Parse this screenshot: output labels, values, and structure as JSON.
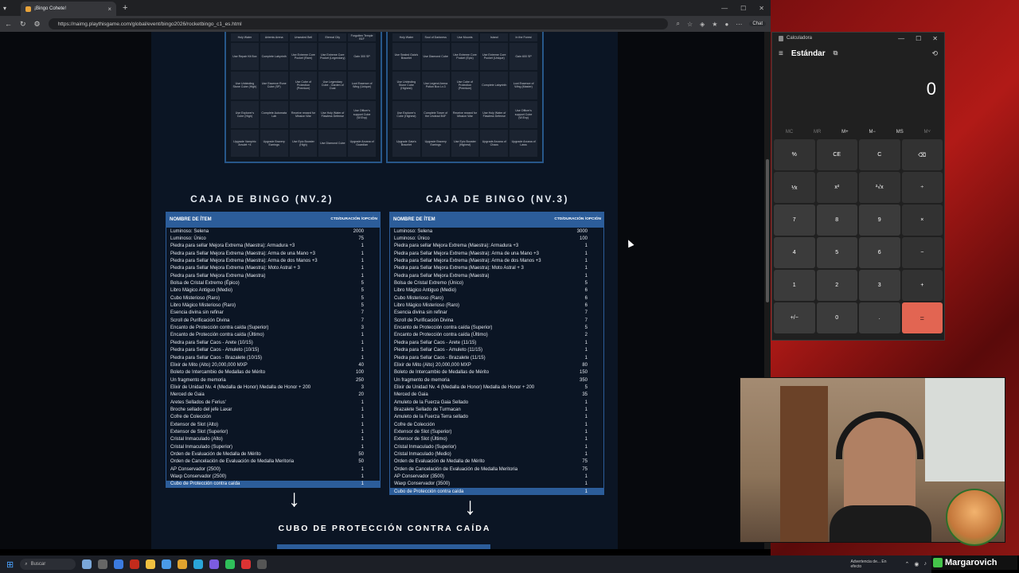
{
  "browser": {
    "tab_title": "¡Bingo Cohete!",
    "url": "https://naimg.playthisgame.com/global/event/bingo2026/rocketbingo_c1_es.html",
    "chat_label": "Chat"
  },
  "grids": {
    "left_cells": [
      "Holy Water",
      "Artemis Arena",
      "Unsealed Bell",
      "Eternal City",
      "Forgotten Temple B1F",
      "Use Repair Kit Box",
      "Complete Labyrinth",
      "Use Extreme Core Pocket (Rare)",
      "Use Extreme Core Pocket (Legendary)",
      "Gain 300 SP",
      "Use Unbinding Stone Cube (High)",
      "Use Essence Rune Cube (SP)",
      "Use Cube of Protection (Premium)",
      "Use Legendary Cube - Garden of Dust",
      "Loot Essence of Wing (Unique)",
      "Use Explorer's Cube (High)",
      "Complete Automata Lab",
      "Receive reward for Mission War",
      "Use Holy Water of Flawless Defense",
      "Use Officer's support Cube (W.Exp)",
      "Upgrade Vampiric Amulet +4",
      "Upgrade Bravery Earrings",
      "Use Epic Booster (High)",
      "Use Diamond Cube",
      "Upgrade Arcana of Guardian"
    ],
    "right_cells": [
      "Holy Water",
      "Soul of Darkness",
      "Use Mounts",
      "Island",
      "In the Forest",
      "Use Sealed Gaia's Bracelet",
      "Use Diamond Cube",
      "Use Extreme Core Pocket (Epic)",
      "Use Extreme Core Pocket (Unique)",
      "Gain 600 SP",
      "Use Unbinding Stone Cube (Highest)",
      "Use Legend Arena Potion Box Lv.3",
      "Use Cube of Protection (Premium)",
      "Complete Labyrinth",
      "Loot Essence of Wing (Master)",
      "Use Explorer's Cube (Highest)",
      "Complete Tower of the Undead B4F",
      "Receive reward for Mission War",
      "Use Holy Water of Flawless Defense",
      "Use Officer's support Cube (W.Exp)",
      "Upgrade Gaia's Bracelet",
      "Upgrade Bravery Earrings",
      "Use Epic Booster (Highest)",
      "Upgrade Arcana of Chaos",
      "Upgrade Arcana of Laws"
    ]
  },
  "tables": [
    {
      "title": "CAJA DE BINGO (NV.2)",
      "col_name": "NOMBRE DE ÍTEM",
      "col_qty": "CTD/DURACIÓN /OPCIÓN",
      "rows": [
        [
          "Luminoso: Selena",
          "2000"
        ],
        [
          "Luminoso: Único",
          "75"
        ],
        [
          "Piedra para sellar Mejora Extrema (Maestra): Armadura +3",
          "1"
        ],
        [
          "Piedra para Sellar Mejora Extrema (Maestra): Arma de una Mano +3",
          "1"
        ],
        [
          "Piedra para Sellar Mejora Extrema (Maestra): Arma de dos Manos +3",
          "1"
        ],
        [
          "Piedra para Sellar Mejora Extrema (Maestra): Moto Astral + 3",
          "1"
        ],
        [
          "Piedra para Sellar Mejora Extrema (Maestra)",
          "1"
        ],
        [
          "Bolsa de Cristal Extremo (Épico)",
          "5"
        ],
        [
          "Libro Mágico Antiguo (Medio)",
          "5"
        ],
        [
          "Cubo Misterioso (Raro)",
          "5"
        ],
        [
          "Libro Mágico Misterioso (Raro)",
          "5"
        ],
        [
          "Esencia divina sin refinar",
          "7"
        ],
        [
          "Scroll de Purificación Divina",
          "7"
        ],
        [
          "Encanto de Protección contra caída (Superior)",
          "3"
        ],
        [
          "Encanto de Protección contra caída (Último)",
          "1"
        ],
        [
          "Piedra para Sellar Caos - Arete (10/15)",
          "1"
        ],
        [
          "Piedra para Sellar Caos - Amuleto (10/15)",
          "1"
        ],
        [
          "Piedra para Sellar Caos - Brazalete (10/15)",
          "1"
        ],
        [
          "Elixir de Mito (Alto) 20,000,000 MXP",
          "40"
        ],
        [
          "Boleto de Intercambio de Medallas de Mérito",
          "100"
        ],
        [
          "Un fragmento de memoria",
          "250"
        ],
        [
          "Elixir de Unidad Nv. 4 (Medalla de Honor) Medalla de Honor + 200",
          "3"
        ],
        [
          "Merced de Gaia",
          "20"
        ],
        [
          "Aretes Sellados de Ferius'",
          "1"
        ],
        [
          "Broche sellado del jefe Laxar",
          "1"
        ],
        [
          "Cofre de Colección",
          "1"
        ],
        [
          "Extensor de Slot (Alto)",
          "1"
        ],
        [
          "Extensor de Slot (Superior)",
          "1"
        ],
        [
          "Cristal Inmaculado (Alto)",
          "1"
        ],
        [
          "Cristal Inmaculado (Superior)",
          "1"
        ],
        [
          "Orden de Evaluación de Medalla de Mérito",
          "50"
        ],
        [
          "Orden de Cancelación de Evaluación de Medalla Meritoria",
          "50"
        ],
        [
          "AP Conservador (2500)",
          "1"
        ],
        [
          "Waxp Conservador (2500)",
          "1"
        ],
        [
          "Cubo de Protección contra caída",
          "1"
        ]
      ]
    },
    {
      "title": "CAJA DE BINGO (NV.3)",
      "col_name": "NOMBRE DE ÍTEM",
      "col_qty": "CTD/DURACIÓN /OPCIÓN",
      "rows": [
        [
          "Luminoso: Selena",
          "3000"
        ],
        [
          "Luminoso: Único",
          "100"
        ],
        [
          "Piedra para sellar Mejora Extrema (Maestra): Armadura +3",
          "1"
        ],
        [
          "Piedra para Sellar Mejora Extrema (Maestra): Arma de una Mano +3",
          "1"
        ],
        [
          "Piedra para Sellar Mejora Extrema (Maestra): Arma de dos Manos +3",
          "1"
        ],
        [
          "Piedra para Sellar Mejora Extrema (Maestra): Moto Astral + 3",
          "1"
        ],
        [
          "Piedra para Sellar Mejora Extrema (Maestra)",
          "1"
        ],
        [
          "Bolsa de Cristal Extremo (Único)",
          "5"
        ],
        [
          "Libro Mágico Antiguo (Medio)",
          "6"
        ],
        [
          "Cubo Misterioso (Raro)",
          "6"
        ],
        [
          "Libro Mágico Misterioso (Raro)",
          "6"
        ],
        [
          "Esencia divina sin refinar",
          "7"
        ],
        [
          "Scroll de Purificación Divina",
          "7"
        ],
        [
          "Encanto de Protección contra caída (Superior)",
          "5"
        ],
        [
          "Encanto de Protección contra caída (Último)",
          "2"
        ],
        [
          "Piedra para Sellar Caos - Arete (11/15)",
          "1"
        ],
        [
          "Piedra para Sellar Caos - Amuleto (11/15)",
          "1"
        ],
        [
          "Piedra para Sellar Caos - Brazalete (11/15)",
          "1"
        ],
        [
          "Elixir de Mito (Alto) 20,000,000 MXP",
          "80"
        ],
        [
          "Boleto de Intercambio de Medallas de Mérito",
          "150"
        ],
        [
          "Un fragmento de memoria",
          "350"
        ],
        [
          "Elixir de Unidad Nv. 4 (Medalla de Honor) Medalla de Honor + 200",
          "5"
        ],
        [
          "Merced de Gaia",
          "35"
        ],
        [
          "Amuleto de la Fuerza Gaia Sellado",
          "1"
        ],
        [
          "Brazalete Sellado de Turmacan",
          "1"
        ],
        [
          "Amuleto de la Fuerza Terra sellado",
          "1"
        ],
        [
          "Cofre de Colección",
          "1"
        ],
        [
          "Extensor de Slot (Superior)",
          "1"
        ],
        [
          "Extensor de Slot (Último)",
          "1"
        ],
        [
          "Cristal Inmaculado (Superior)",
          "1"
        ],
        [
          "Cristal Inmaculado (Medio)",
          "1"
        ],
        [
          "Orden de Evaluación de Medalla de Mérito",
          "75"
        ],
        [
          "Orden de Cancelación de Evaluación de Medalla Meritoria",
          "75"
        ],
        [
          "AP Conservador (3500)",
          "1"
        ],
        [
          "Waxp Conservador (3500)",
          "1"
        ],
        [
          "Cubo de Protección contra caída",
          "1"
        ]
      ]
    }
  ],
  "bottom_title": "CUBO DE PROTECCIÓN CONTRA CAÍDA",
  "calculator": {
    "app_title": "Calculadora",
    "mode": "Estándar",
    "display": "0",
    "memory": [
      "MC",
      "MR",
      "M+",
      "M−",
      "MS",
      "M˅"
    ],
    "keys": [
      "%",
      "CE",
      "C",
      "⌫",
      "⅟x",
      "x²",
      "²√x",
      "÷",
      "7",
      "8",
      "9",
      "×",
      "4",
      "5",
      "6",
      "−",
      "1",
      "2",
      "3",
      "+",
      "+/−",
      "0",
      ".",
      "="
    ]
  },
  "taskbar": {
    "search": "Buscar",
    "notice": "Advertencia de... En efecto"
  },
  "streamer": {
    "name": "Margarovich"
  },
  "colors": {
    "accent": "#2c5d9a",
    "equals": "#e26552"
  }
}
